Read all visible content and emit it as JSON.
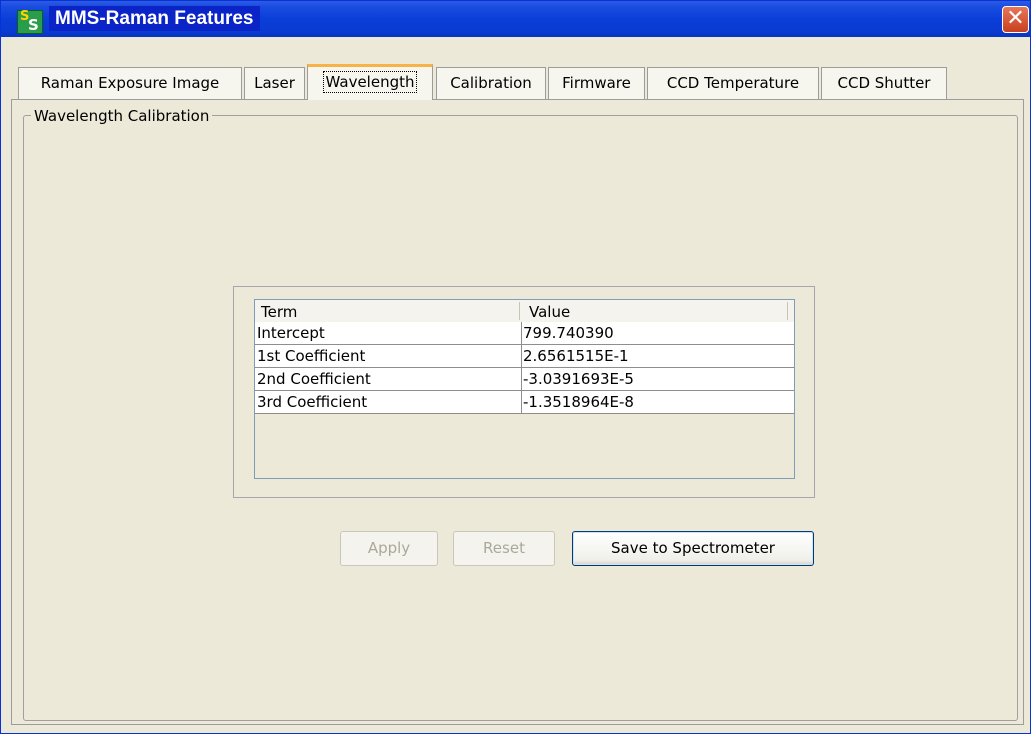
{
  "window": {
    "title": "MMS-Raman Features",
    "icon_letters": [
      "S",
      "S"
    ]
  },
  "tabs": [
    {
      "label": "Raman Exposure Image",
      "active": false
    },
    {
      "label": "Laser",
      "active": false
    },
    {
      "label": "Wavelength",
      "active": true
    },
    {
      "label": "Calibration",
      "active": false
    },
    {
      "label": "Firmware",
      "active": false
    },
    {
      "label": "CCD Temperature",
      "active": false
    },
    {
      "label": "CCD Shutter",
      "active": false
    }
  ],
  "group": {
    "title": "Wavelength Calibration"
  },
  "table": {
    "headers": [
      "Term",
      "Value"
    ],
    "rows": [
      [
        "Intercept",
        "799.740390"
      ],
      [
        "1st Coefficient",
        "2.6561515E-1"
      ],
      [
        "2nd Coefficient",
        "-3.0391693E-5"
      ],
      [
        "3rd Coefficient",
        "-1.3518964E-8"
      ]
    ]
  },
  "buttons": {
    "apply": "Apply",
    "reset": "Reset",
    "save": "Save to Spectrometer"
  },
  "colors": {
    "titlebar": "#0a3ed8",
    "active_tab_accent": "#f7b24a",
    "window_bg": "#ece9d8"
  },
  "icons": {
    "app": "app-logo-icon",
    "close": "close-icon"
  }
}
